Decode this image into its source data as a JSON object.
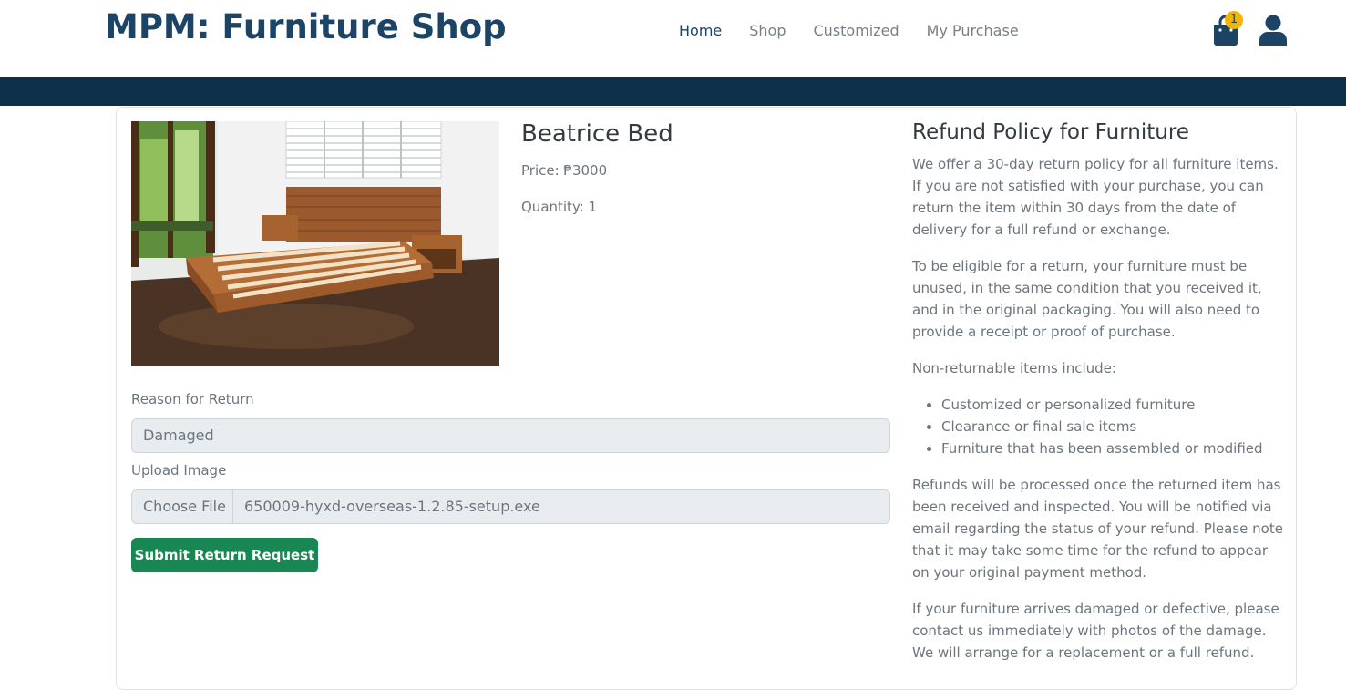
{
  "header": {
    "brand": "MPM: Furniture Shop",
    "nav": {
      "home": "Home",
      "shop": "Shop",
      "customized": "Customized",
      "my_purchase": "My Purchase"
    },
    "cart_count": "1",
    "colors": {
      "brand": "#1c4466",
      "banner": "#0d2f47",
      "badge": "#f5b400"
    }
  },
  "product": {
    "name": "Beatrice Bed",
    "price": "Price: ₱3000",
    "quantity": "Quantity: 1"
  },
  "form": {
    "reason_label": "Reason for Return",
    "reason_value": "Damaged",
    "upload_label": "Upload Image",
    "file_button": "Choose File",
    "file_name": "650009-hyxd-overseas-1.2.85-setup.exe",
    "submit_label": "Submit Return Request",
    "submit_color": "#198754"
  },
  "policy": {
    "title": "Refund Policy for Furniture",
    "p1": "We offer a 30-day return policy for all furniture items. If you are not satisfied with your purchase, you can return the item within 30 days from the date of delivery for a full refund or exchange.",
    "p2": "To be eligible for a return, your furniture must be unused, in the same condition that you received it, and in the original packaging. You will also need to provide a receipt or proof of purchase.",
    "p3": "Non-returnable items include:",
    "items": [
      "Customized or personalized furniture",
      "Clearance or final sale items",
      "Furniture that has been assembled or modified"
    ],
    "p4": "Refunds will be processed once the returned item has been received and inspected. You will be notified via email regarding the status of your refund. Please note that it may take some time for the refund to appear on your original payment method.",
    "p5": "If your furniture arrives damaged or defective, please contact us immediately with photos of the damage. We will arrange for a replacement or a full refund."
  }
}
